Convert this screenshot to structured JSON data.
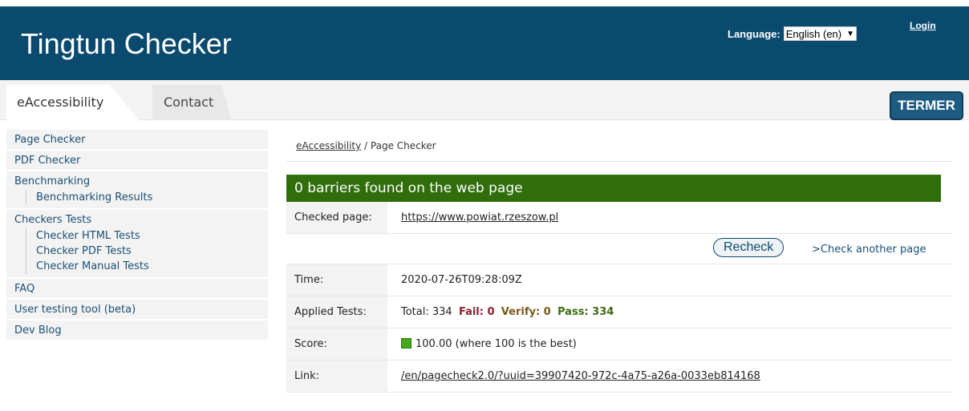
{
  "header": {
    "title": "Tingtun Checker",
    "language_label": "Language:",
    "language_selected": "English (en)",
    "login": "Login"
  },
  "tabs": [
    {
      "label": "eAccessibility",
      "active": true
    },
    {
      "label": "Contact",
      "active": false
    }
  ],
  "termer": "TERMER",
  "sidebar": {
    "page_checker": "Page Checker",
    "pdf_checker": "PDF Checker",
    "benchmarking": "Benchmarking",
    "benchmarking_results": "Benchmarking Results",
    "checkers_tests": "Checkers Tests",
    "checker_html_tests": "Checker HTML Tests",
    "checker_pdf_tests": "Checker PDF Tests",
    "checker_manual_tests": "Checker Manual Tests",
    "faq": "FAQ",
    "user_testing_tool": "User testing tool (beta)",
    "dev_blog": "Dev Blog"
  },
  "breadcrumb": {
    "root": "eAccessibility",
    "separator": " / ",
    "current": "Page Checker"
  },
  "banner": "0 barriers found on the web page",
  "result": {
    "checked_page_label": "Checked page:",
    "checked_page_url": "https://www.powiat.rzeszow.pl",
    "recheck": "Recheck",
    "check_another": ">Check another page",
    "time_label": "Time:",
    "time_value": "2020-07-26T09:28:09Z",
    "applied_label": "Applied Tests:",
    "total": "Total: 334",
    "fail": "Fail: 0",
    "verify": "Verify: 0",
    "pass": "Pass: 334",
    "score_label": "Score:",
    "score_value": "100.00 (where 100 is the best)",
    "link_label": "Link:",
    "link_value": "/en/pagecheck2.0/?uuid=39907420-972c-4a75-a26a-0033eb814168"
  },
  "colors": {
    "header_bg": "#0a4a6e",
    "banner_bg": "#2f6e0b",
    "score_green": "#43a81a"
  }
}
